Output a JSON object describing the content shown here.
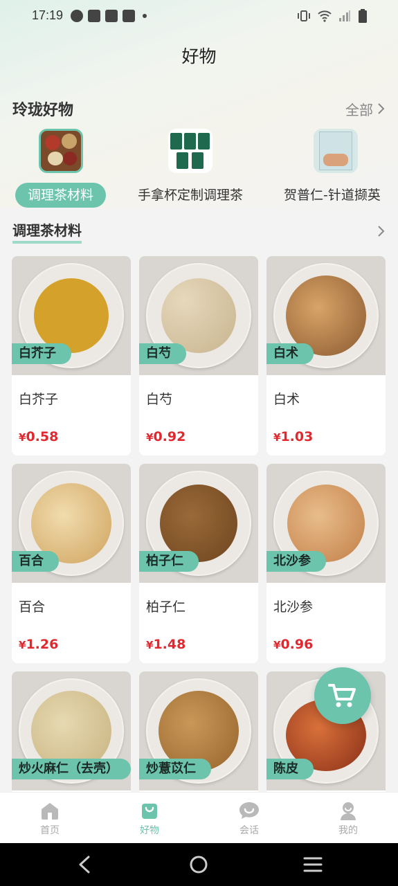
{
  "status_bar": {
    "time": "17:19"
  },
  "page": {
    "title": "好物"
  },
  "section": {
    "title": "玲珑好物",
    "all_label": "全部"
  },
  "categories": [
    {
      "label": "调理茶材料",
      "active": true
    },
    {
      "label": "手拿杯定制调理茶",
      "active": false
    },
    {
      "label": "贺普仁-针道撷英",
      "active": false
    }
  ],
  "sub_section": {
    "title": "调理茶材料"
  },
  "currency": "¥",
  "products": [
    {
      "tag": "白芥子",
      "name": "白芥子",
      "price": "0.58",
      "color": "#d4a12a"
    },
    {
      "tag": "白芍",
      "name": "白芍",
      "price": "0.92",
      "color": "#d9c8a8"
    },
    {
      "tag": "白术",
      "name": "白术",
      "price": "1.03",
      "color": "#a86f3d"
    },
    {
      "tag": "百合",
      "name": "百合",
      "price": "1.26",
      "color": "#e3c88e"
    },
    {
      "tag": "柏子仁",
      "name": "柏子仁",
      "price": "1.48",
      "color": "#8a5a2e"
    },
    {
      "tag": "北沙参",
      "name": "北沙参",
      "price": "0.96",
      "color": "#d6a06a"
    },
    {
      "tag": "炒火麻仁（去壳）",
      "name": "",
      "price": "",
      "color": "#d8c79a"
    },
    {
      "tag": "炒薏苡仁",
      "name": "",
      "price": "",
      "color": "#b07a3a"
    },
    {
      "tag": "陈皮",
      "name": "",
      "price": "",
      "color": "#c0502a"
    }
  ],
  "tabs": [
    {
      "label": "首页",
      "icon": "home-icon",
      "active": false
    },
    {
      "label": "好物",
      "icon": "bag-icon",
      "active": true
    },
    {
      "label": "会话",
      "icon": "chat-icon",
      "active": false
    },
    {
      "label": "我的",
      "icon": "user-icon",
      "active": false
    }
  ],
  "colors": {
    "accent": "#6cc4ad",
    "price": "#e0282e"
  }
}
